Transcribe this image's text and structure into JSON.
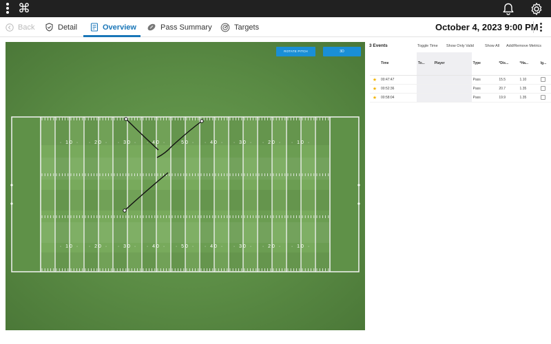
{
  "topbar": {
    "icons": [
      "kebab-icon",
      "command-icon",
      "bell-icon",
      "gear-icon"
    ],
    "cmd_glyph": "⌘"
  },
  "nav": {
    "back": "Back",
    "detail": "Detail",
    "overview": "Overview",
    "pass_summary": "Pass Summary",
    "targets": "Targets",
    "date": "October 4, 2023 9:00 PM",
    "active_color": "#1976b8"
  },
  "field": {
    "rotate_label": "ROTATE PITCH",
    "view_label": "3D",
    "button_color": "#1a8fd6",
    "top_numbers": [
      "10",
      "20",
      "30",
      "40",
      "50",
      "40",
      "30",
      "20",
      "10"
    ],
    "bottom_numbers": [
      "10",
      "20",
      "30",
      "40",
      "50",
      "40",
      "30",
      "20",
      "10"
    ]
  },
  "events": {
    "count_label": "3 Events",
    "toggle_time": "Toggle Time",
    "show_only_valid": "Show Only Valid",
    "show_all": "Show All",
    "add_remove": "Add/Remove Metrics",
    "columns": [
      "",
      "Time",
      "To...",
      "Player",
      "Type",
      "*Dis...",
      "*Ha...",
      "Ig..."
    ],
    "rows": [
      {
        "time": "00:47:47",
        "to": "",
        "player": "",
        "type": "Pass",
        "dist": "15.5",
        "hang": "1.10"
      },
      {
        "time": "00:52:36",
        "to": "",
        "player": "",
        "type": "Pass",
        "dist": "20.7",
        "hang": "1.35"
      },
      {
        "time": "00:58:04",
        "to": "",
        "player": "",
        "type": "Pass",
        "dist": "19.9",
        "hang": "1.35"
      }
    ],
    "star_color": "#f2b400"
  }
}
